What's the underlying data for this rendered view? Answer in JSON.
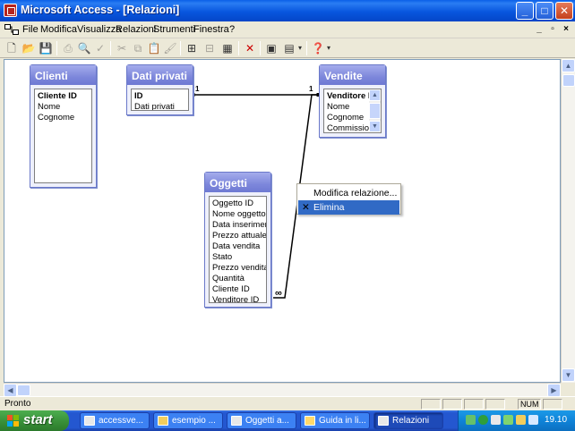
{
  "window": {
    "title": "Microsoft Access - [Relazioni]",
    "minimize": "_",
    "maximize": "□",
    "close": "✕"
  },
  "menubar": {
    "items": [
      "File",
      "Modifica",
      "Visualizza",
      "Relazioni",
      "Strumenti",
      "Finestra",
      "?"
    ],
    "mdi_min": "_",
    "mdi_restore": "▫",
    "mdi_close": "×"
  },
  "tables": {
    "clienti": {
      "title": "Clienti",
      "fields": [
        "Cliente ID",
        "Nome",
        "Cognome"
      ],
      "pk": "Cliente ID"
    },
    "dati_privati": {
      "title": "Dati privati",
      "fields": [
        "ID",
        "Dati privati"
      ],
      "pk": "ID"
    },
    "vendite": {
      "title": "Vendite",
      "fields": [
        "Venditore ID",
        "Nome",
        "Cognome",
        "Commissione"
      ],
      "pk": "Venditore ID"
    },
    "oggetti": {
      "title": "Oggetti",
      "fields": [
        "Oggetto ID",
        "Nome oggetto",
        "Data inserimento",
        "Prezzo attuale",
        "Data vendita",
        "Stato",
        "Prezzo vendita",
        "Quantità",
        "Cliente ID",
        "Venditore ID"
      ],
      "pk": ""
    }
  },
  "relations": {
    "one_label": "1",
    "many_label": "∞"
  },
  "context_menu": {
    "items": [
      "Modifica relazione...",
      "Elimina"
    ],
    "selected": "Elimina"
  },
  "statusbar": {
    "text": "Pronto",
    "num_indicator": "NUM"
  },
  "taskbar": {
    "start_label": "start",
    "tasks": [
      {
        "label": "accessve...",
        "active": false
      },
      {
        "label": "esempio ...",
        "active": false
      },
      {
        "label": "Oggetti a...",
        "active": false
      },
      {
        "label": "Guida in li...",
        "active": false
      },
      {
        "label": "Relazioni",
        "active": true
      }
    ],
    "clock": "19.10"
  }
}
